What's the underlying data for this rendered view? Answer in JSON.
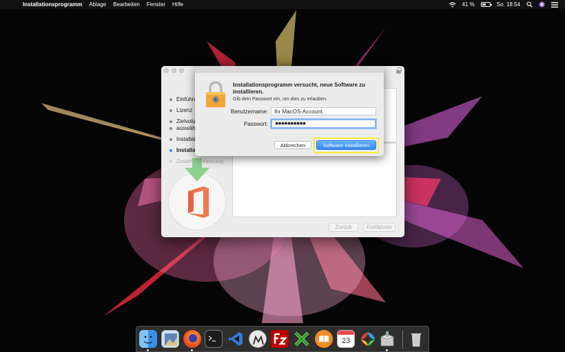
{
  "menubar": {
    "app_name": "Installationsprogramm",
    "items": [
      "Ablage",
      "Bearbeiten",
      "Fenster",
      "Hilfe"
    ],
    "battery_percent": "41 %",
    "clock": "So. 18:54"
  },
  "installer": {
    "steps": [
      {
        "label": "Einführu",
        "state": "done"
      },
      {
        "label": "Lizenz",
        "state": "done"
      },
      {
        "label": "Zielvolu",
        "state": "done"
      },
      {
        "label": "auswähl",
        "state": "done"
      },
      {
        "label": "Installat",
        "state": "done"
      },
      {
        "label": "Installat",
        "state": "active"
      },
      {
        "label": "Zusammenfassung",
        "state": "pending"
      }
    ],
    "back_label": "Zurück",
    "continue_label": "Fortfahren"
  },
  "auth_sheet": {
    "title": "Installationsprogramm versucht, neue Software zu installieren.",
    "subtitle": "Gib dein Passwort ein, um dies zu erlauben.",
    "username_label": "Benutzername:",
    "username_value": "Ihr MacOS-Account",
    "password_label": "Passwort:",
    "password_value": "●●●●●●●●●●",
    "cancel_label": "Abbrechen",
    "confirm_label": "Software installieren"
  },
  "dock": {
    "apps": [
      {
        "name": "finder-icon"
      },
      {
        "name": "preview-icon"
      },
      {
        "name": "firefox-icon"
      },
      {
        "name": "terminal-icon"
      },
      {
        "name": "vscode-icon"
      },
      {
        "name": "mindnode-icon"
      },
      {
        "name": "filezilla-icon"
      },
      {
        "name": "xcode-tools-icon"
      },
      {
        "name": "ibooks-icon"
      },
      {
        "name": "calendar-icon",
        "label": "23"
      },
      {
        "name": "codekit-icon"
      },
      {
        "name": "installer-icon"
      },
      {
        "name": "trash-icon"
      }
    ]
  }
}
